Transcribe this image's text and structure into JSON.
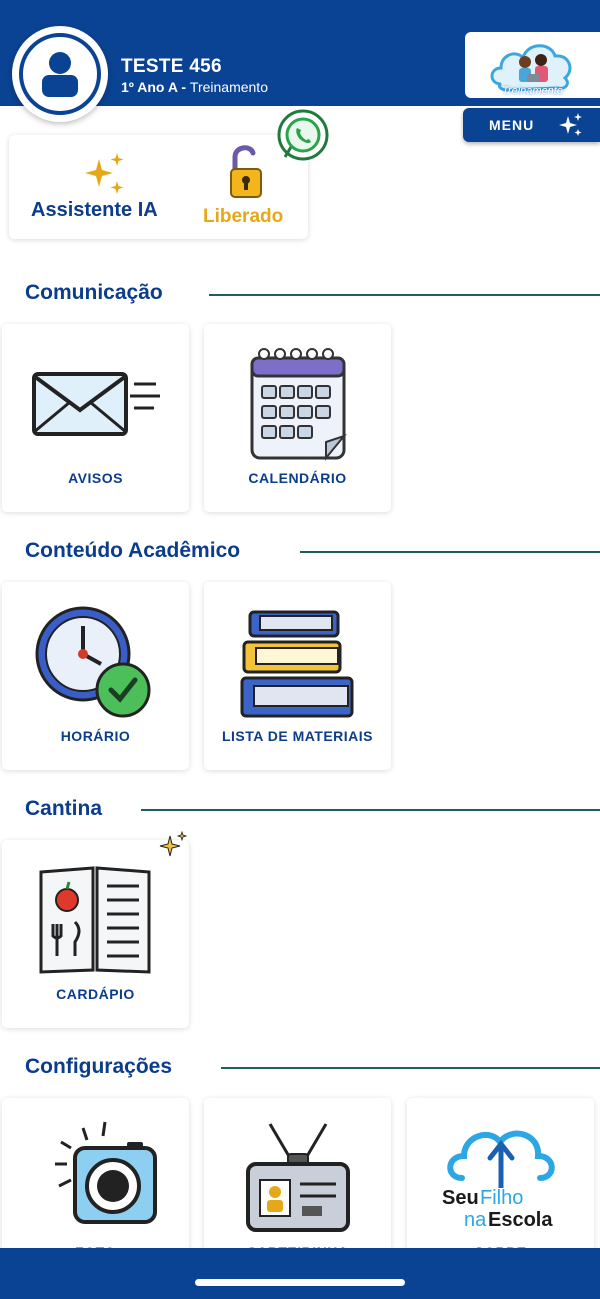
{
  "header": {
    "user_name": "TESTE 456",
    "class_name": "1º Ano A",
    "class_separator": " - ",
    "class_mode": "Treinamento",
    "logo_caption": "Treinamento",
    "menu_label": "MENU"
  },
  "ai_card": {
    "title": "Assistente IA",
    "status": "Liberado"
  },
  "sections": [
    {
      "title": "Comunicação",
      "tiles": [
        {
          "label": "AVISOS",
          "icon": "envelope-icon"
        },
        {
          "label": "CALENDÁRIO",
          "icon": "calendar-icon"
        }
      ]
    },
    {
      "title": "Conteúdo Acadêmico",
      "tiles": [
        {
          "label": "HORÁRIO",
          "icon": "clock-icon"
        },
        {
          "label": "LISTA DE MATERIAIS",
          "icon": "books-icon"
        }
      ]
    },
    {
      "title": "Cantina",
      "tiles": [
        {
          "label": "CARDÁPIO",
          "icon": "menu-book-icon"
        }
      ]
    },
    {
      "title": "Configurações",
      "tiles": [
        {
          "label": "FOTO",
          "icon": "camera-icon"
        },
        {
          "label": "CARTEIRINHA",
          "icon": "id-card-icon"
        },
        {
          "label": "SOBRE",
          "icon": "seufilho-cloud-icon",
          "logo_text": "SeuFilhonaEscola"
        }
      ]
    }
  ],
  "colors": {
    "primary": "#0a4393",
    "accent_gold": "#e6a818",
    "section_line": "#1f5f5b"
  }
}
